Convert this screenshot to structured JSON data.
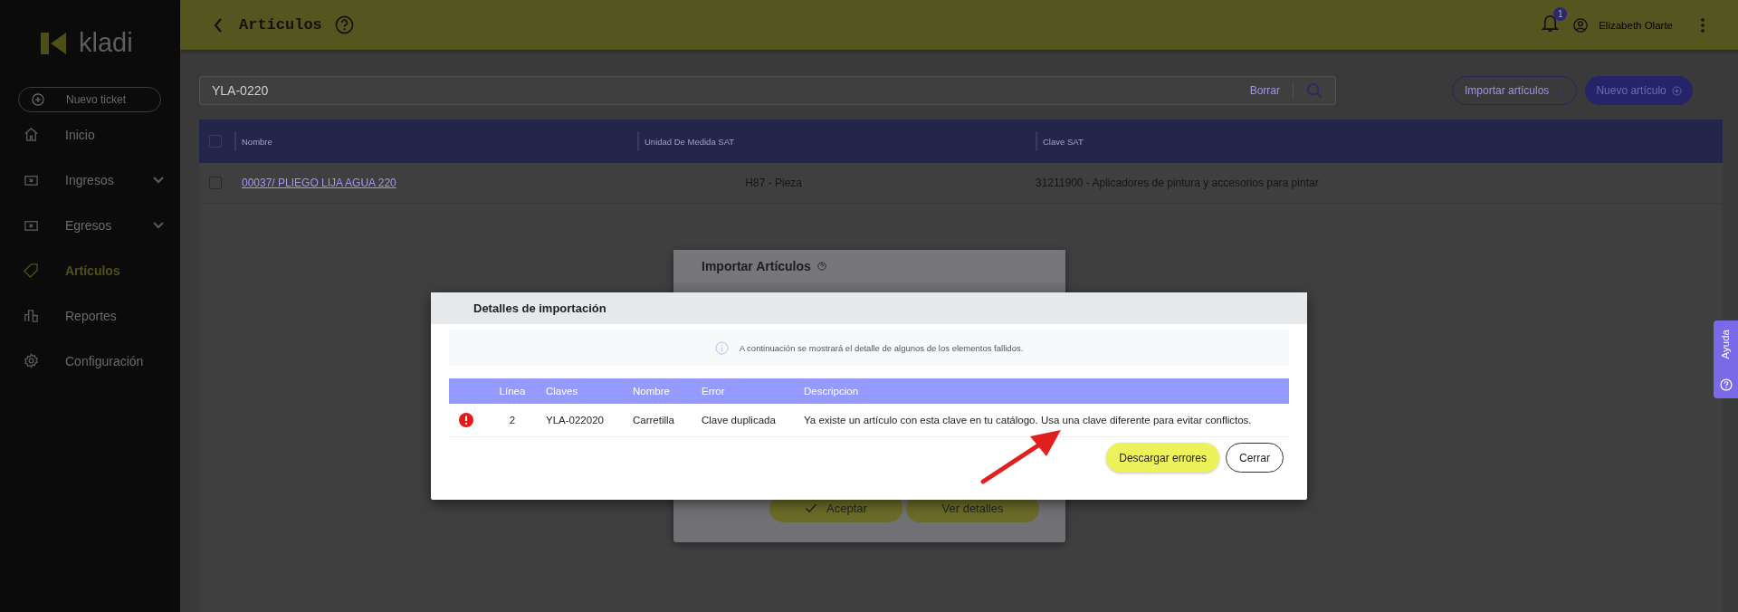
{
  "sidebar": {
    "logo": "kladi",
    "new_ticket": "Nuevo ticket",
    "items": [
      {
        "label": "Inicio",
        "selected": false,
        "has_submenu": false
      },
      {
        "label": "Ingresos",
        "selected": false,
        "has_submenu": true
      },
      {
        "label": "Egresos",
        "selected": false,
        "has_submenu": true
      },
      {
        "label": "Artículos",
        "selected": true,
        "has_submenu": false
      },
      {
        "label": "Reportes",
        "selected": false,
        "has_submenu": false
      },
      {
        "label": "Configuración",
        "selected": false,
        "has_submenu": false
      }
    ]
  },
  "header": {
    "title": "Artículos",
    "notification_count": "1",
    "user_name": "Elizabeth Olarte"
  },
  "toolbar": {
    "search_value": "YLA-0220",
    "clear": "Borrar",
    "import_button": "Importar artículos",
    "new_button": "Nuevo artículo"
  },
  "table": {
    "select_all_checked": false,
    "columns": [
      "Nombre",
      "Unidad De Medida SAT",
      "Clave SAT"
    ],
    "rows": [
      {
        "checked": false,
        "name": "00037/ PLIEGO LIJA AGUA 220",
        "unit": "H87 - Pieza",
        "sat_key": "31211900 - Aplicadores de pintura y accesorios para pintar"
      }
    ]
  },
  "background_dialog": {
    "title": "Importar Artículos",
    "buttons": [
      "Aceptar",
      "Ver detalles"
    ]
  },
  "dialog": {
    "title": "Detalles de importación",
    "info": "A continuación se mostrará el detalle de algunos de los elementos fallidos.",
    "columns": [
      "Línea",
      "Claves",
      "Nombre",
      "Error",
      "Descripcion"
    ],
    "rows": [
      {
        "kind": "error",
        "line": "2",
        "key": "YLA-022020",
        "name": "Carretilla",
        "error": "Clave duplicada",
        "description": "Ya existe un artículo con esta clave en tu catálogo. Usa una clave diferente para evitar conflictos."
      }
    ],
    "download_button": "Descargar errores",
    "close_button": "Cerrar"
  },
  "help_tab": "Ayuda"
}
